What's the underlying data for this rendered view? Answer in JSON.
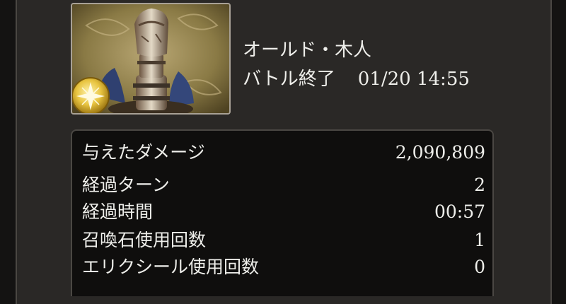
{
  "enemy": {
    "name": "オールド・木人",
    "status": "バトル終了",
    "datetime": "01/20 14:55"
  },
  "stats": [
    {
      "label": "与えたダメージ",
      "value": "2,090,809"
    },
    {
      "label": "経過ターン",
      "value": "2"
    },
    {
      "label": "経過時間",
      "value": "00:57"
    },
    {
      "label": "召喚石使用回数",
      "value": "1"
    },
    {
      "label": "エリクシール使用回数",
      "value": "0"
    }
  ],
  "icons": {
    "portrait": "wooden-dummy-portrait",
    "element": "light-element-icon"
  },
  "colors": {
    "background": "#2a2826",
    "panel": "#0f0e0d",
    "text": "#eeeeea",
    "element_gold": "#e8c440"
  }
}
